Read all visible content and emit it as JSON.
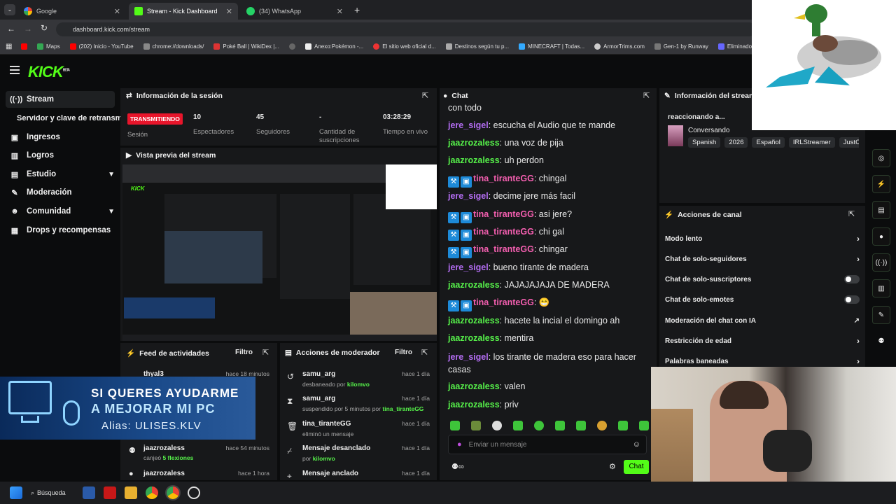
{
  "browser": {
    "tabs": [
      {
        "title": "Google"
      },
      {
        "title": "Stream - Kick Dashboard"
      },
      {
        "title": "(34) WhatsApp"
      }
    ],
    "url": "dashboard.kick.com/stream",
    "bookmarks": [
      "Maps",
      "(202) Inicio - YouTube",
      "chrome://downloads/",
      "Poké Ball | WikiDex |...",
      "Anexo:Pokémon -...",
      "El sitio web oficial d...",
      "Destinos según tu p...",
      "MINECRAFT | Todas...",
      "ArmorTrims.com",
      "Gen-1 by Runway",
      "Eliminador d"
    ]
  },
  "brand": {
    "logo": "KICK",
    "beta": "BETA",
    "accent": "#53fc18"
  },
  "sidebar": {
    "items": [
      {
        "label": "Stream"
      },
      {
        "label": "Servidor y clave de retransmisión"
      },
      {
        "label": "Ingresos"
      },
      {
        "label": "Logros"
      },
      {
        "label": "Estudio"
      },
      {
        "label": "Moderación"
      },
      {
        "label": "Comunidad"
      },
      {
        "label": "Drops y recompensas"
      }
    ]
  },
  "session": {
    "title": "Información de la sesión",
    "status": "TRANSMITIENDO",
    "status_label": "Sesión",
    "stats": [
      {
        "value": "10",
        "label": "Espectadores"
      },
      {
        "value": "45",
        "label": "Seguidores"
      },
      {
        "value": "-",
        "label": "Cantidad de suscripciones"
      },
      {
        "value": "03:28:29",
        "label": "Tiempo en vivo"
      }
    ]
  },
  "preview": {
    "title": "Vista previa del stream"
  },
  "overlay": {
    "line1": "SI QUERES AYUDARME",
    "line2": "A MEJORAR MI PC",
    "line3": "Alias: ULISES.KLV"
  },
  "feed": {
    "title": "Feed de actividades",
    "filter": "Filtro",
    "items": [
      {
        "name": "thyal3",
        "time": "hace 18 minutos",
        "detail": ""
      },
      {
        "name": "jaazrozaless",
        "time": "hace 54 minutos",
        "detail_prefix": "canjeó",
        "detail_hl": "5 flexiones"
      },
      {
        "name": "jaazrozaless",
        "time": "hace 1 hora",
        "detail": ""
      }
    ]
  },
  "modactions": {
    "title": "Acciones de moderador",
    "filter": "Filtro",
    "items": [
      {
        "name": "samu_arg",
        "time": "hace 1 día",
        "text": "desbaneado por",
        "by": "kilomvo"
      },
      {
        "name": "samu_arg",
        "time": "hace 1 día",
        "text": "suspendido por 5 minutos por",
        "by": "tina_tiranteGG"
      },
      {
        "name": "tina_tiranteGG",
        "time": "hace 1 día",
        "text": "eliminó un mensaje",
        "by": ""
      },
      {
        "name": "Mensaje desanclado",
        "time": "hace 1 día",
        "text": "por",
        "by": "kilomvo"
      },
      {
        "name": "Mensaje anclado",
        "time": "hace 1 día",
        "text": "",
        "by": ""
      }
    ]
  },
  "chat": {
    "title": "Chat",
    "messages": [
      {
        "user": "",
        "text": "con todo"
      },
      {
        "user": "jere_sigel",
        "text": "escucha el Audio que te mande"
      },
      {
        "user": "jaazrozaless",
        "text": "una voz de pija"
      },
      {
        "user": "jaazrozaless",
        "text": "uh perdon"
      },
      {
        "user": "tina_tiranteGG",
        "text": "chingal"
      },
      {
        "user": "jere_sigel",
        "text": "decime jere más facil"
      },
      {
        "user": "tina_tiranteGG",
        "text": "asi jere?"
      },
      {
        "user": "tina_tiranteGG",
        "text": "chi gal"
      },
      {
        "user": "tina_tiranteGG",
        "text": "chingar"
      },
      {
        "user": "jere_sigel",
        "text": "bueno tirante de madera"
      },
      {
        "user": "jaazrozaless",
        "text": "JAJAJAJAJA DE MADERA"
      },
      {
        "user": "tina_tiranteGG",
        "text": "😁"
      },
      {
        "user": "jaazrozaless",
        "text": "hacete la incial el domingo ah"
      },
      {
        "user": "jaazrozaless",
        "text": "mentira"
      },
      {
        "user": "jere_sigel",
        "text": "los tirante de madera eso para hacer casas"
      },
      {
        "user": "jaazrozaless",
        "text": "valen"
      },
      {
        "user": "jaazrozaless",
        "text": "priv"
      }
    ],
    "placeholder": "Enviar un mensaje",
    "send": "Chat"
  },
  "streaminfo": {
    "title": "Información del stream",
    "stream_title": "reaccionando a...",
    "category": "Conversando",
    "tags": [
      "Spanish",
      "2026",
      "Español",
      "IRLStreamer",
      "JustC"
    ]
  },
  "channel_actions": {
    "title": "Acciones de canal",
    "items": [
      {
        "label": "Modo lento",
        "ctrl": "chevron"
      },
      {
        "label": "Chat de solo-seguidores",
        "ctrl": "chevron"
      },
      {
        "label": "Chat de solo-suscriptores",
        "ctrl": "toggle"
      },
      {
        "label": "Chat de solo-emotes",
        "ctrl": "toggle"
      },
      {
        "label": "Moderación del chat con IA",
        "ctrl": "external"
      },
      {
        "label": "Restricción de edad",
        "ctrl": "chevron"
      },
      {
        "label": "Palabras baneadas",
        "ctrl": "chevron"
      }
    ]
  },
  "taskbar": {
    "search": "Búsqueda"
  }
}
